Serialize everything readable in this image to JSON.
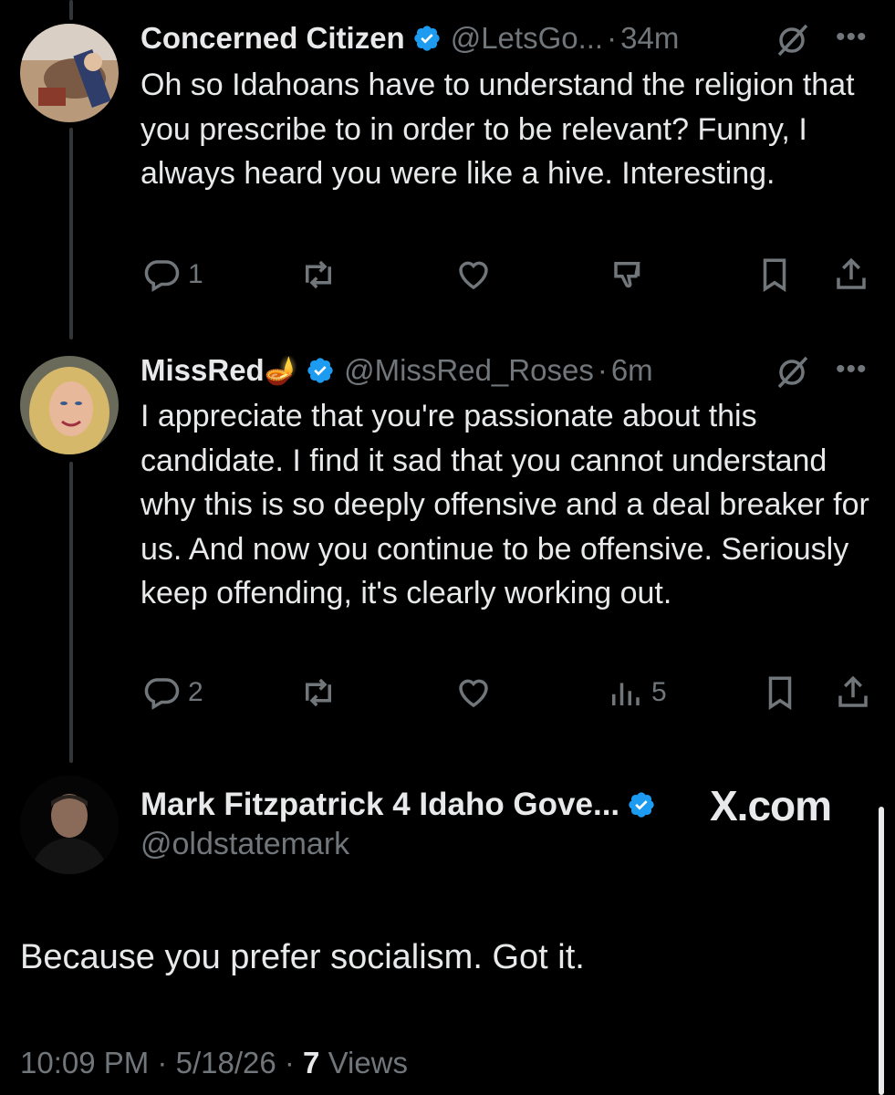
{
  "tweets": [
    {
      "name": "Concerned Citizen",
      "handle": "@LetsGo...",
      "time": "34m",
      "text": "Oh so Idahoans have to understand the religion that you prescribe to in order to be relevant?  Funny, I always heard you were like a hive.  Interesting.",
      "replies": "1",
      "reposts": "",
      "likes": "",
      "views": ""
    },
    {
      "name": "MissRed",
      "name_emoji": "🪔",
      "handle": "@MissRed_Roses",
      "time": "6m",
      "text": "I appreciate that you're passionate about this candidate. I find it sad that you cannot understand why this is so deeply offensive and a deal breaker for us. And now you continue to be offensive. Seriously keep offending, it's clearly working out.",
      "replies": "2",
      "reposts": "",
      "likes": "",
      "views": "5"
    }
  ],
  "main": {
    "name": "Mark Fitzpatrick 4 Idaho Gove...",
    "handle": "@oldstatemark",
    "watermark": "X.com",
    "text": "Because you prefer socialism. Got it.",
    "time": "10:09 PM",
    "date": "5/18/26",
    "views_count": "7",
    "views_label": "Views"
  },
  "separator": "·",
  "more_label": "•••",
  "colors": {
    "background": "#000000",
    "text": "#e7e9ea",
    "muted": "#71767b",
    "verified": "#1d9bf0"
  },
  "icons": [
    "verified-badge-icon",
    "grok-icon",
    "more-icon",
    "reply-icon",
    "repost-icon",
    "like-icon",
    "dislike-icon",
    "views-icon",
    "bookmark-icon",
    "share-icon"
  ]
}
